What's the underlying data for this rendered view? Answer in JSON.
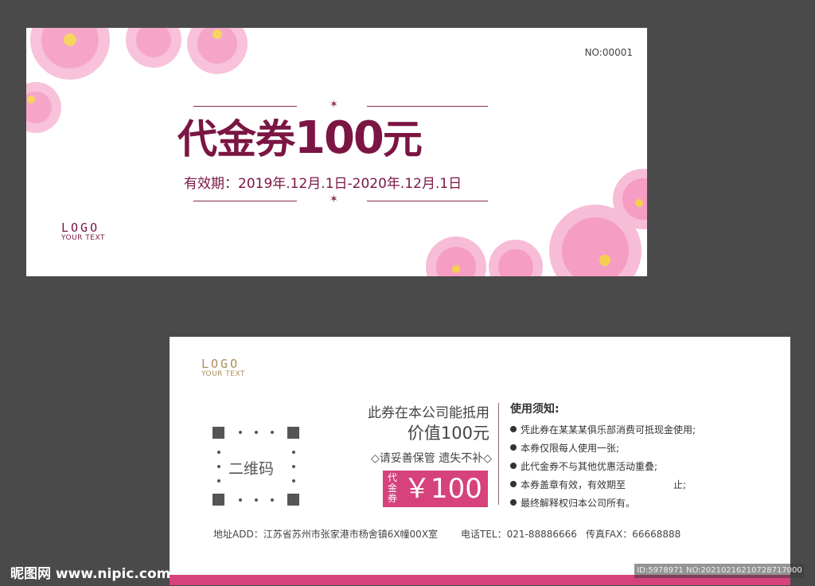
{
  "front": {
    "serial": "NO:00001",
    "title_cn": "代金券",
    "title_amount": "100",
    "title_unit": "元",
    "validity": "有效期：2019年.12月.1日-2020年.12月.1日",
    "logo_mark": "LOGO",
    "logo_sub": "YOUR TEXT"
  },
  "back": {
    "logo_mark": "LOGO",
    "logo_sub": "YOUR TEXT",
    "qr_label": "二维码",
    "use_line1": "此券在本公司能抵用",
    "use_line2": "价值100元",
    "keep_note": "◇请妥善保管 遗失不补◇",
    "coupon_vertical": "代金券",
    "coupon_price": "￥100",
    "notes_title": "使用须知:",
    "notes": [
      "凭此券在某某某俱乐部消费可抵现金使用;",
      "本券仅限每人使用一张;",
      "此代金券不与其他优惠活动重叠;",
      "本券盖章有效，有效期至　　　　　止;",
      "最终解释权归本公司所有。"
    ],
    "address": "地址ADD：江苏省苏州市张家港市杨舍镇6X幢00X室",
    "phone": "电话TEL：021-88886666",
    "fax": "传真FAX：66668888"
  },
  "watermark": {
    "site": "昵图网 www.nipic.com",
    "id_text": "ID:5978971 NO:20210216210728717000"
  },
  "colors": {
    "background": "#4a4a4a",
    "burgundy": "#7b1543",
    "pink": "#d6427b",
    "gold": "#a98d5b"
  }
}
